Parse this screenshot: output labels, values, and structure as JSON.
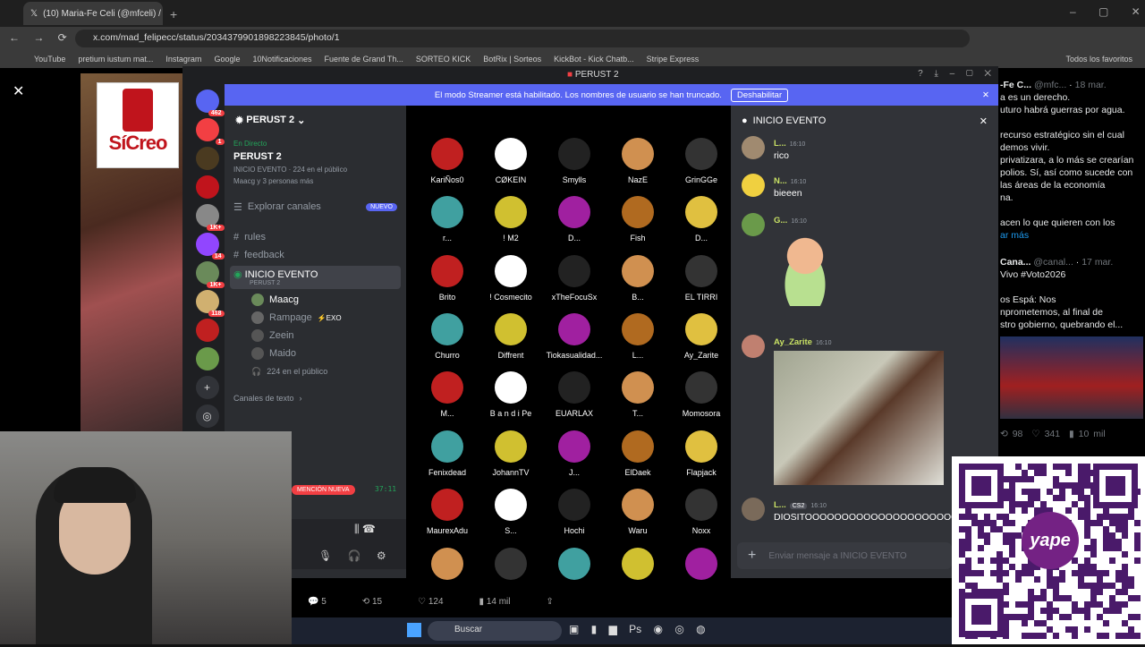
{
  "browser": {
    "tab_title": "(10) Maria-Fe Celi (@mfceli) / X",
    "url": "x.com/mad_felipecc/status/2034379901898223845/photo/1",
    "bookmarks": [
      "YouTube",
      "pretium iustum mat...",
      "Instagram",
      "Google",
      "10Notificaciones",
      "Fuente de Grand Th...",
      "SORTEO KICK",
      "BotRix | Sorteos",
      "KickBot - Kick Chatb...",
      "Stripe Express"
    ],
    "all_favorites": "Todos los favoritos"
  },
  "left_logo": "SíCreo",
  "discord": {
    "window_title": "PERUST 2",
    "banner_text": "El modo Streamer está habilitado. Los nombres de usuario se han truncado.",
    "banner_button": "Deshabilitar",
    "server_badges": [
      "462",
      "1",
      "1K+",
      "14",
      "1K+",
      "118"
    ],
    "server_name": "PERUST 2",
    "live_label": "En Directo",
    "live_title": "PERUST 2",
    "live_event": "INICIO EVENTO",
    "live_public": "224 en el público",
    "live_people": "Maacg y 3 personas más",
    "explore": "Explorar canales",
    "new_badge": "NUEVO",
    "channels": [
      "rules",
      "feedback"
    ],
    "stage_channel": "INICIO EVENTO",
    "stage_sub": "PERUST 2",
    "members": [
      "Maacg",
      "Rampage",
      "Zeein",
      "Maido"
    ],
    "rampage_tag": "EXO",
    "audience": "224 en el público",
    "text_channels": "Canales de texto",
    "mention": "MENCIÓN NUEVA",
    "timer": "37:11",
    "users": [
      "KariÑos0",
      "CØKEIN",
      "Smylls",
      "NazE",
      "GrinGGe",
      "r...",
      "! M2",
      "D...",
      "Fish",
      "D...",
      "Brito",
      "! Cosmecito",
      "xTheFocuSx",
      "B...",
      "EL TIRRI",
      "Churro",
      "Diffrent",
      "Tiokasualidad...",
      "L...",
      "Ay_Zarite",
      "M...",
      "B a n d i Pe",
      "EUARLAX",
      "T...",
      "Momosora",
      "Fenixdead",
      "JohannTV",
      "J...",
      "ElDaek",
      "Flapjack",
      "MaurexAdu",
      "S...",
      "Hochi",
      "Waru",
      "Noxx"
    ],
    "chat_title": "INICIO EVENTO",
    "messages": [
      {
        "name": "L...",
        "time": "16:10",
        "text": "rico"
      },
      {
        "name": "N...",
        "time": "16:10",
        "text": "bieeen"
      },
      {
        "name": "G...",
        "time": "16:10",
        "text": ""
      },
      {
        "name": "Ay_Zarite",
        "time": "16:10",
        "text": ""
      },
      {
        "name": "L...",
        "tag": "CS2",
        "time": "16:10",
        "text": "DIOSITOOOOOOOOOOOOOOOOOOOOOO"
      }
    ],
    "input_placeholder": "Enviar mensaje a INICIO EVENTO"
  },
  "tweet_right": {
    "name": "-Fe C...",
    "handle": "@mfc...",
    "date": "18 mar.",
    "lines": [
      "a es un derecho.",
      "uturo habrá guerras por agua.",
      "recurso estratégico sin el cual",
      "demos vivir.",
      "privatizara, a lo más se crearían",
      "polios. Sí, así como sucede con",
      "las áreas de la economía",
      "na.",
      "acen lo que quieren con los"
    ],
    "more": "ar más",
    "t2_name": "Cana...",
    "t2_handle": "@canal...",
    "t2_date": "17 mar.",
    "t2_lines": [
      "Vivo #Voto2026",
      "os Espá: Nos",
      "nprometemos, al final de",
      "stro gobierno, quebrando el..."
    ],
    "stats": [
      "98",
      "341",
      "10 mil"
    ]
  },
  "tweet_actions": [
    "5",
    "15",
    "124",
    "14 mil"
  ],
  "taskbar_search": "Buscar",
  "qr_brand": "yape"
}
